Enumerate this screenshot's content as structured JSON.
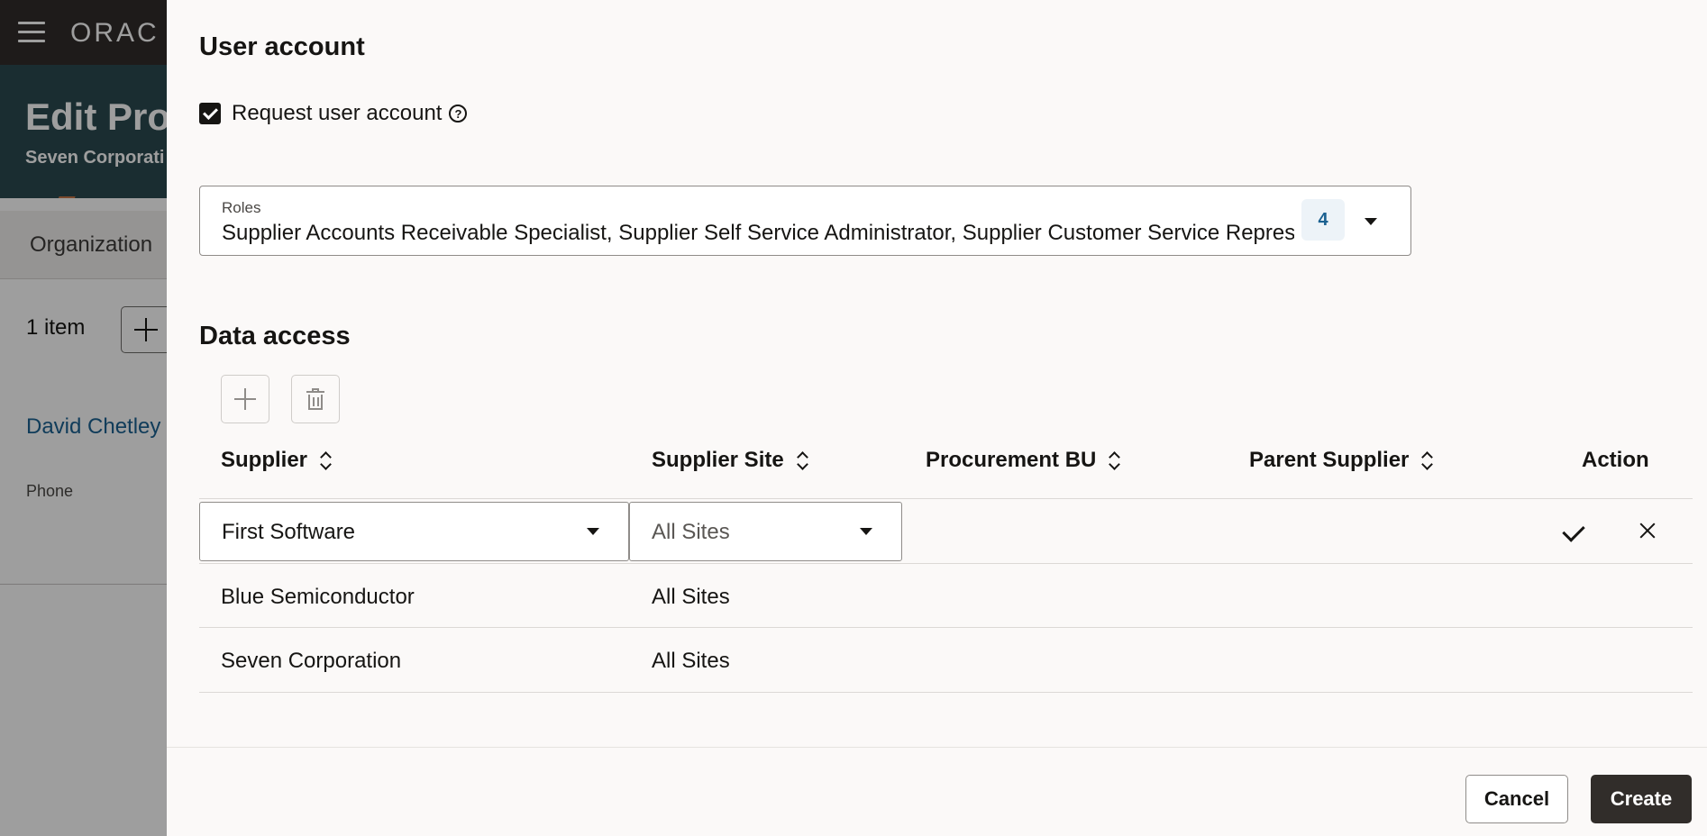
{
  "background": {
    "brand": "ORAC",
    "page_title": "Edit Pro",
    "page_subtitle": "Seven Corporati",
    "tab_label": "Organization",
    "items_count": "1 item",
    "contact_name": "David Chetley",
    "phone_label": "Phone"
  },
  "drawer": {
    "user_account_title": "User account",
    "request_checkbox_label": "Request user account",
    "request_checked": true,
    "roles": {
      "label": "Roles",
      "value": "Supplier Accounts Receivable Specialist, Supplier Self Service Administrator, Supplier Customer Service Representative",
      "count": "4"
    },
    "data_access_title": "Data access",
    "columns": [
      "Supplier",
      "Supplier Site",
      "Procurement BU",
      "Parent Supplier",
      "Action"
    ],
    "edit_row": {
      "supplier": "First Software",
      "supplier_site": "All Sites"
    },
    "rows": [
      {
        "supplier": "Blue Semiconductor",
        "supplier_site": "All Sites"
      },
      {
        "supplier": "Seven Corporation",
        "supplier_site": "All Sites"
      }
    ],
    "cancel_label": "Cancel",
    "create_label": "Create"
  },
  "colors": {
    "header_bg": "#312d2a",
    "hero_bg": "#2b4a4f",
    "link": "#1b6191",
    "primary_button": "#312d2a",
    "drawer_bg": "#fbf9f8"
  }
}
